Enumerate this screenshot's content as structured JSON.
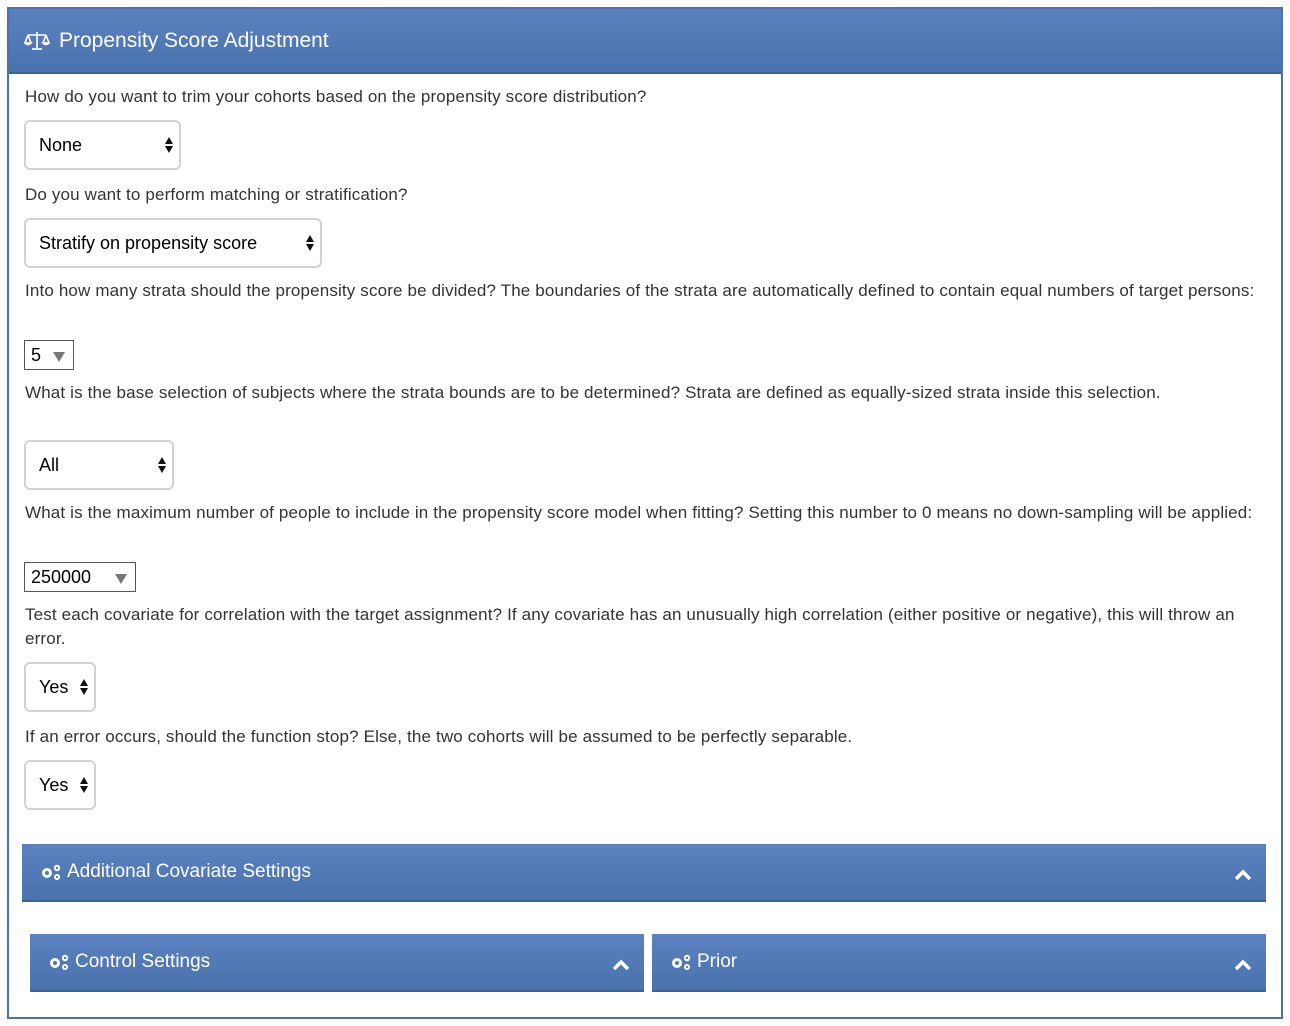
{
  "panel": {
    "title": "Propensity Score Adjustment",
    "icon": "balance-scale-icon"
  },
  "trim": {
    "question": "How do you want to trim your cohorts based on the propensity score distribution?",
    "value": "None"
  },
  "match": {
    "question": "Do you want to perform matching or stratification?",
    "value": "Stratify on propensity score"
  },
  "strata": {
    "question": "Into how many strata should the propensity score be divided? The boundaries of the strata are automatically defined to contain equal numbers of target persons:",
    "value": "5"
  },
  "base_selection": {
    "question": "What is the base selection of subjects where the strata bounds are to be determined? Strata are defined as equally-sized strata inside this selection.",
    "value": "All"
  },
  "max_people": {
    "question": "What is the maximum number of people to include in the propensity score model when fitting? Setting this number to 0 means no down-sampling will be applied:",
    "value": "250000"
  },
  "correlation_test": {
    "question": "Test each covariate for correlation with the target assignment? If any covariate has an unusually high correlation (either positive or negative), this will throw an error.",
    "value": "Yes"
  },
  "stop_on_error": {
    "question": "If an error occurs, should the function stop? Else, the two cohorts will be assumed to be perfectly separable.",
    "value": "Yes"
  },
  "sections": {
    "additional_covariate": "Additional Covariate Settings",
    "control": "Control Settings",
    "prior": "Prior"
  },
  "colors": {
    "header": "#4a72ad",
    "border": "#4a72ad",
    "text": "#333333"
  }
}
